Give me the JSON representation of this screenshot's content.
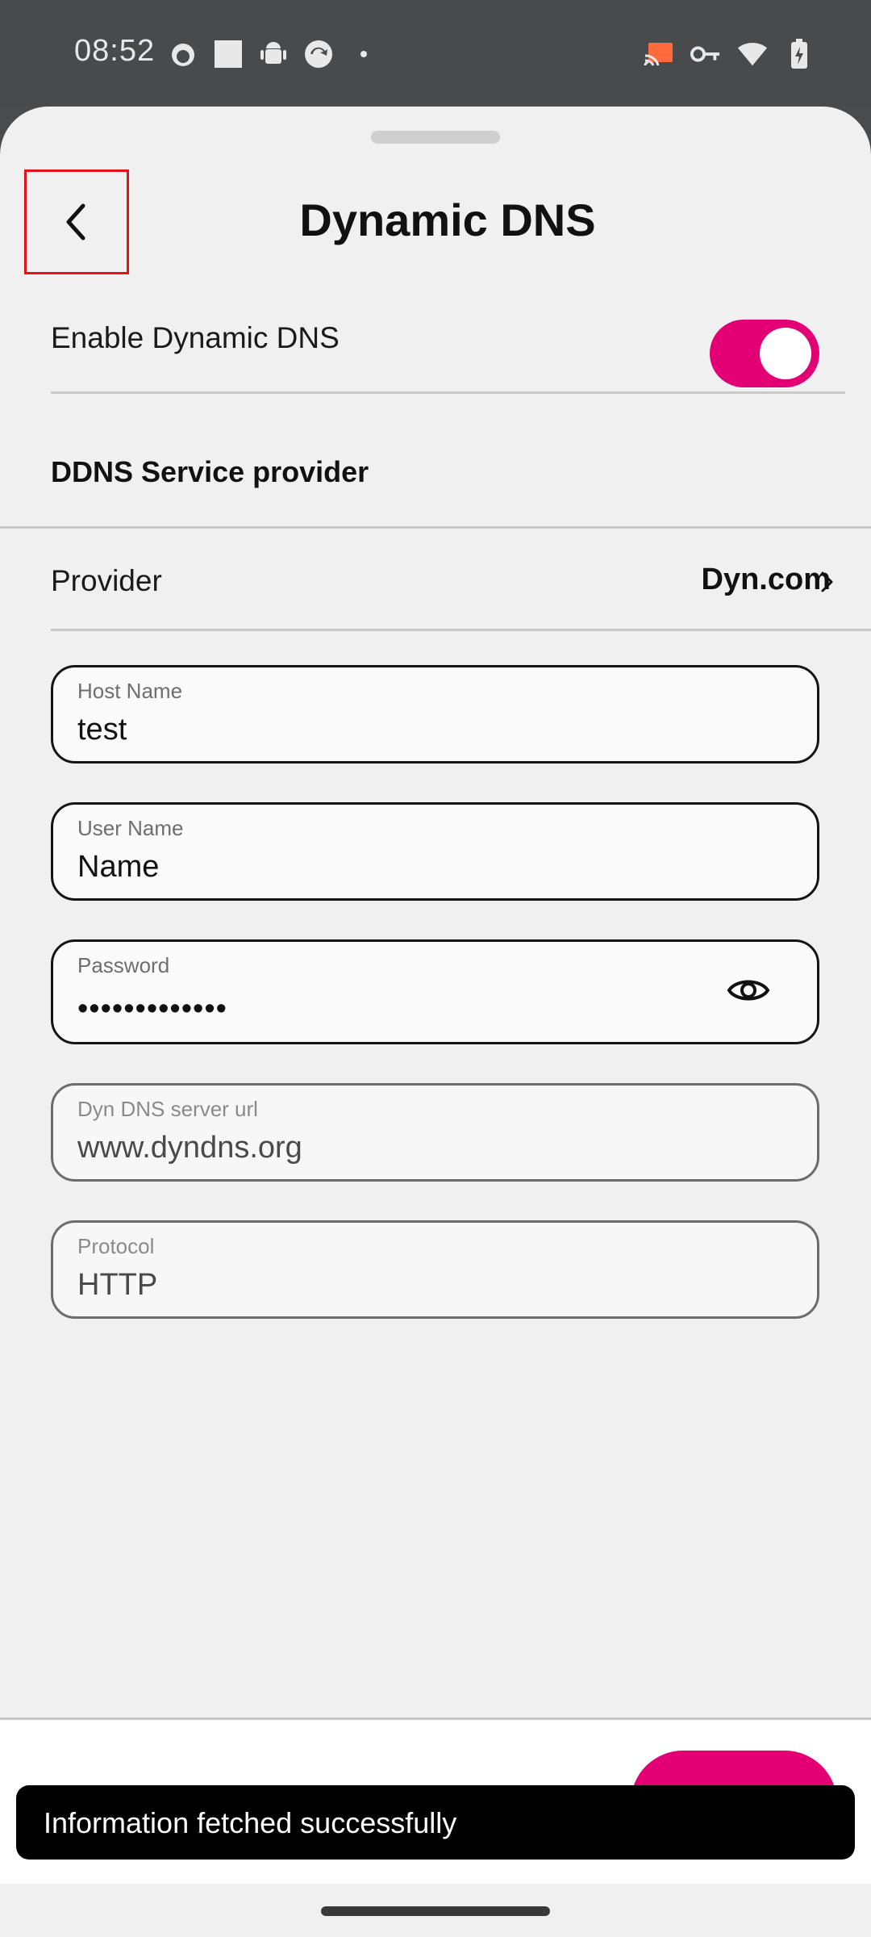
{
  "status_bar": {
    "time": "08:52",
    "left_icons": [
      "cat-notification-icon",
      "square-app-icon",
      "android-icon",
      "sync-app-icon",
      "dot-icon"
    ],
    "right_icons": [
      "cast-icon",
      "vpn-key-icon",
      "wifi-icon",
      "battery-icon"
    ]
  },
  "header": {
    "title": "Dynamic DNS",
    "back_icon": "chevron-left-icon"
  },
  "enable_toggle": {
    "label": "Enable Dynamic DNS",
    "checked": true
  },
  "section": {
    "title": "DDNS Service provider"
  },
  "provider": {
    "label": "Provider",
    "value": "Dyn.com"
  },
  "fields": {
    "host_name": {
      "label": "Host Name",
      "value": "test"
    },
    "user_name": {
      "label": "User Name",
      "value": "Name"
    },
    "password": {
      "label": "Password",
      "value": "•••••••••••••"
    },
    "server_url": {
      "label": "Dyn DNS server url",
      "value": "www.dyndns.org"
    },
    "protocol": {
      "label": "Protocol",
      "value": "HTTP"
    }
  },
  "snackbar": {
    "message": "Information fetched successfully"
  },
  "colors": {
    "accent": "#e20074",
    "highlight": "#e3121b",
    "sheet_bg": "#f0f0f0"
  }
}
